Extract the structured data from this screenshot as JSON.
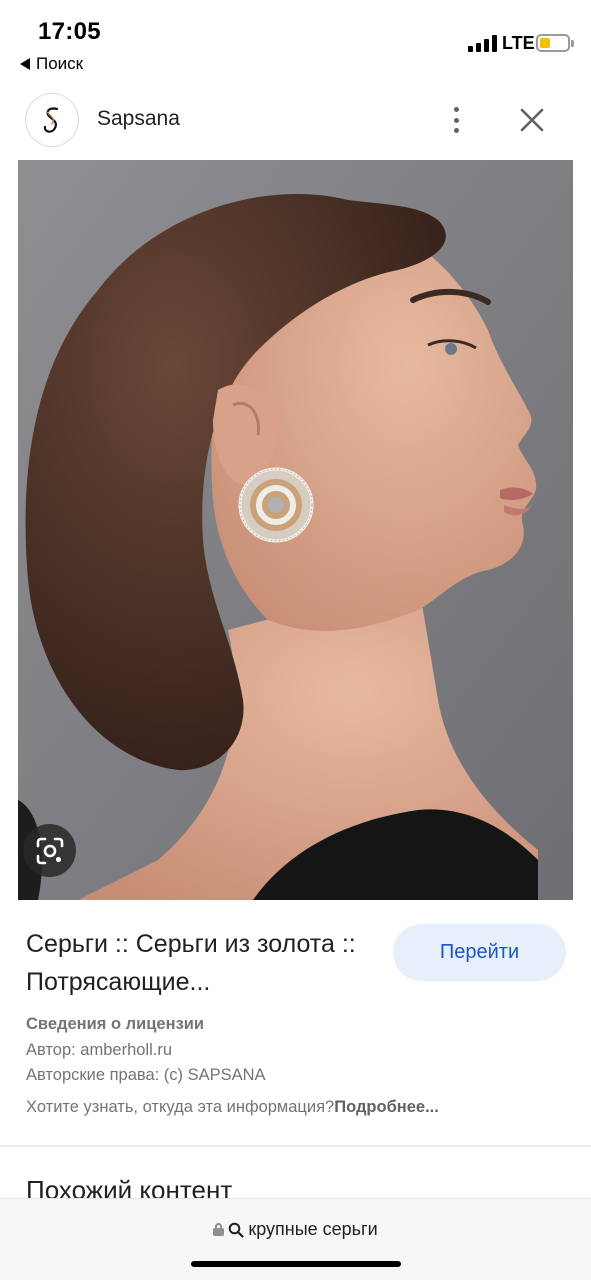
{
  "status_bar": {
    "time": "17:05",
    "back_label": "Поиск",
    "network": "LTE",
    "battery_level": 0.25,
    "battery_color": "#f2c200"
  },
  "header": {
    "logo_icon": "sapsana-logo-icon",
    "site_name": "Sapsana",
    "more_icon": "more-vert-icon",
    "close_icon": "close-icon"
  },
  "image": {
    "lens_icon": "google-lens-icon"
  },
  "result": {
    "title": "Серьги :: Серьги из золота :: Потрясающие...",
    "go_button": "Перейти",
    "license_heading": "Сведения о лицензии",
    "author": "Автор: amberholl.ru",
    "copyright": "Авторские права: (c) SAPSANA",
    "info_question": "Хотите узнать, откуда эта информация?",
    "info_link": "Подробнее..."
  },
  "similar": {
    "heading": "Похожий контент"
  },
  "url_bar": {
    "lock_icon": "lock-icon",
    "search_icon": "search-icon",
    "query": "крупные серьги"
  },
  "colors": {
    "go_button_bg": "#e8effb",
    "go_button_text": "#1a56c4",
    "secondary_text": "#70757a"
  }
}
